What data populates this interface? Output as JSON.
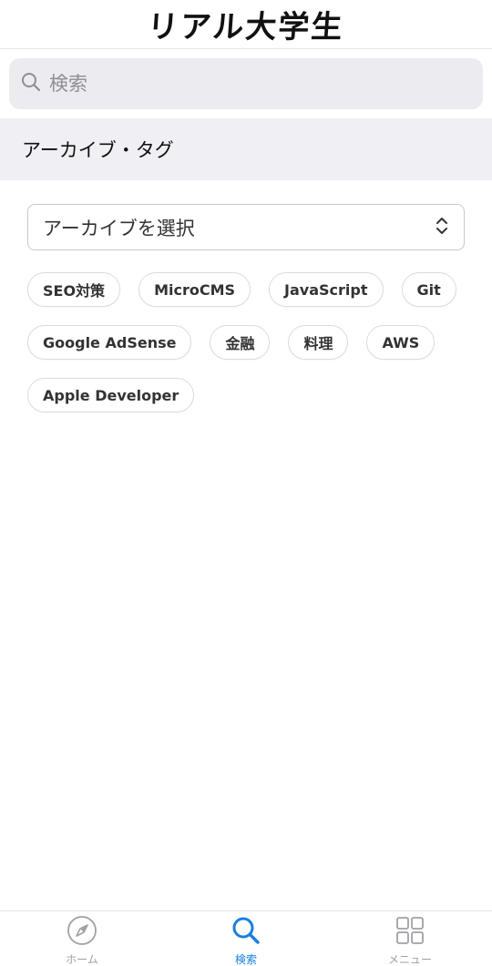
{
  "header": {
    "title": "リアル大学生"
  },
  "search": {
    "placeholder": "検索",
    "icon": "search-icon"
  },
  "section": {
    "title": "アーカイブ・タグ"
  },
  "archive_select": {
    "value": "アーカイブを選択",
    "icon": "chevron-updown-icon"
  },
  "tags": [
    "SEO対策",
    "MicroCMS",
    "JavaScript",
    "Git",
    "Google AdSense",
    "金融",
    "料理",
    "AWS",
    "Apple Developer"
  ],
  "tabbar": {
    "items": [
      {
        "label": "ホーム",
        "icon": "compass-icon",
        "active": false
      },
      {
        "label": "検索",
        "icon": "search-icon",
        "active": true
      },
      {
        "label": "メニュー",
        "icon": "grid-icon",
        "active": false
      }
    ]
  },
  "colors": {
    "accent": "#1a7fe0",
    "inactive": "#a0a0a6",
    "section_bg": "#efeff4",
    "search_bg": "#ececf0"
  }
}
